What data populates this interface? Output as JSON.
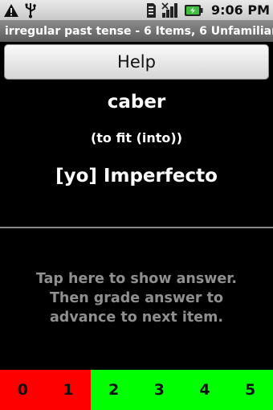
{
  "status_bar": {
    "time": "9:06 PM",
    "icons": [
      "warning-icon",
      "usb-icon",
      "sd-card-icon",
      "signal-icon",
      "battery-icon"
    ]
  },
  "title_bar": {
    "title": "irregular past tense - 6 Items, 6 Unfamiliar"
  },
  "help_button": {
    "label": "Help"
  },
  "question": {
    "word": "caber",
    "meaning": "(to fit (into))",
    "tense": "[yo] Imperfecto"
  },
  "answer": {
    "prompt": "Tap here to show answer. Then grade answer to advance to next item."
  },
  "grades": {
    "items": [
      {
        "label": "0",
        "color": "#ff0000"
      },
      {
        "label": "1",
        "color": "#ff0000"
      },
      {
        "label": "2",
        "color": "#00ff00"
      },
      {
        "label": "3",
        "color": "#00ff00"
      },
      {
        "label": "4",
        "color": "#00ff00"
      },
      {
        "label": "5",
        "color": "#00ff00"
      }
    ]
  }
}
